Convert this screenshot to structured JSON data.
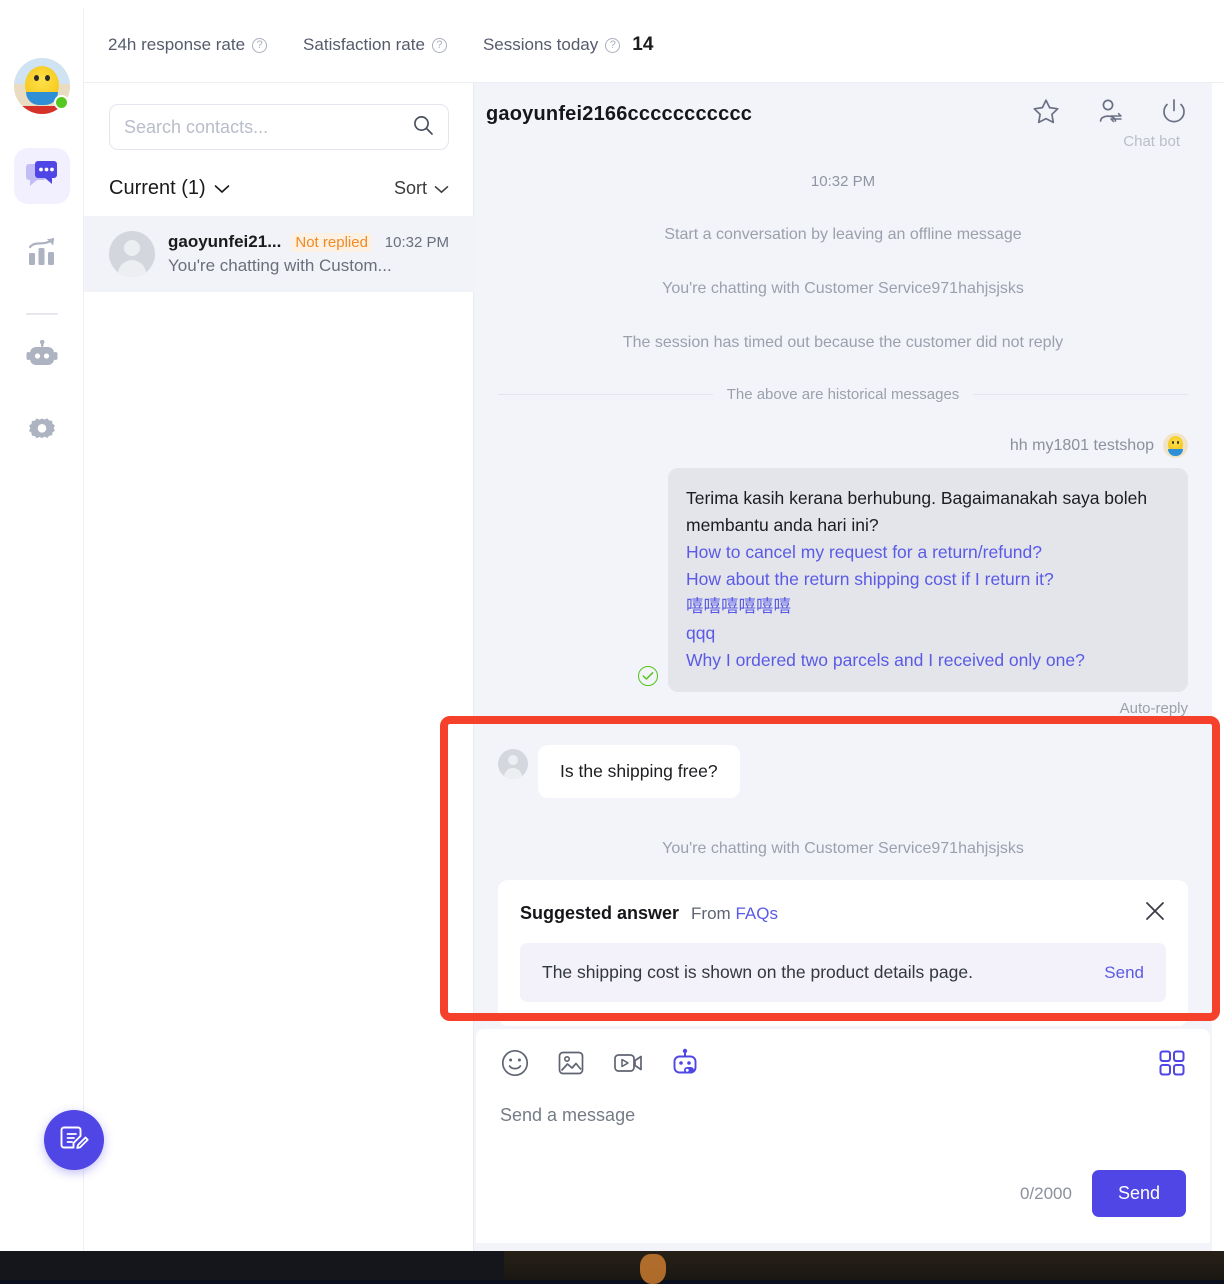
{
  "metrics": [
    {
      "label": "24h response rate",
      "value": "",
      "icon": "help-icon"
    },
    {
      "label": "Satisfaction rate",
      "value": "",
      "icon": "help-icon"
    },
    {
      "label": "Sessions today",
      "value": "14",
      "icon": "help-icon"
    }
  ],
  "rail": {
    "avatar_name": "user-avatar",
    "status": "online",
    "items": [
      {
        "name": "chat-icon",
        "active": true
      },
      {
        "name": "analytics-icon",
        "active": false
      },
      {
        "name": "bot-icon",
        "active": false
      },
      {
        "name": "settings-gear-icon",
        "active": false
      }
    ]
  },
  "contacts": {
    "search_placeholder": "Search contacts...",
    "search_value": "",
    "filter_label": "Current (1)",
    "sort_label": "Sort",
    "list": [
      {
        "name": "gaoyunfei21...",
        "badge": "Not replied",
        "time": "10:32 PM",
        "snippet": "You're chatting with Custom..."
      }
    ]
  },
  "chat": {
    "title": "gaoyunfei2166ccccccccccc",
    "chatbot_label": "Chat bot",
    "actions": [
      {
        "name": "star-icon"
      },
      {
        "name": "transfer-user-icon"
      },
      {
        "name": "end-session-power-icon"
      }
    ],
    "timestamp": "10:32 PM",
    "system_messages": [
      "Start a conversation by leaving an offline message",
      "You're chatting with Customer Service971hahjsjsks",
      "The session has timed out because the customer did not reply"
    ],
    "history_divider": "The above are historical messages",
    "outgoing": {
      "sender": "hh my1801 testshop",
      "text": "Terima kasih kerana berhubung. Bagaimanakah saya boleh membantu anda hari ini?",
      "links": [
        "How to cancel my request for a return/refund?",
        "How about the return shipping cost if I return it?",
        "嘻嘻嘻嘻嘻嘻",
        "qqq",
        "Why I ordered two parcels and I received only one?"
      ],
      "footer": "Auto-reply",
      "status_icon": "sent-check-icon"
    },
    "incoming": {
      "text": "Is the shipping free?"
    },
    "system_message_after": "You're chatting with Customer Service971hahjsjsks",
    "suggested": {
      "title": "Suggested answer",
      "from_label": "From",
      "from_source": "FAQs",
      "answer": "The shipping cost is shown on the product details page.",
      "send_label": "Send",
      "close_icon": "close-icon"
    }
  },
  "composer": {
    "tools": [
      {
        "name": "emoji-icon",
        "active": false
      },
      {
        "name": "image-icon",
        "active": false
      },
      {
        "name": "video-icon",
        "active": false
      },
      {
        "name": "bot-reply-icon",
        "active": true
      }
    ],
    "grid_icon": "apps-grid-icon",
    "placeholder": "Send a message",
    "char_count": "0/2000",
    "send_label": "Send"
  },
  "fab": {
    "name": "compose-note-icon"
  },
  "colors": {
    "accent": "#4f46e5",
    "link": "#5a5ae6",
    "highlight": "#f5402c",
    "warning": "#f08a24",
    "success": "#52c41a",
    "panel_bg": "#f3f4f9"
  }
}
